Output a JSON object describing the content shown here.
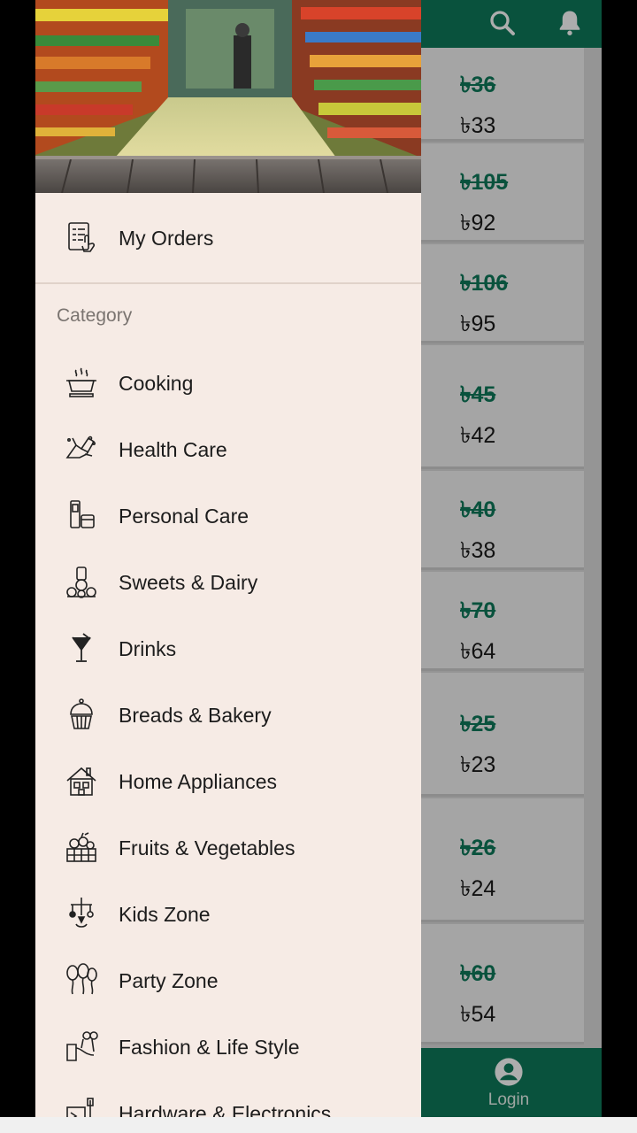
{
  "header": {
    "icons": [
      "search-icon",
      "bell-icon"
    ]
  },
  "price_cards": [
    {
      "old_price": "৳36",
      "new_price": "৳33"
    },
    {
      "old_price": "৳105",
      "new_price": "৳92"
    },
    {
      "old_price": "৳106",
      "new_price": "৳95"
    },
    {
      "old_price": "৳45",
      "new_price": "৳42"
    },
    {
      "old_price": "৳40",
      "new_price": "৳38"
    },
    {
      "old_price": "৳70",
      "new_price": "৳64"
    },
    {
      "old_price": "৳25",
      "new_price": "৳23"
    },
    {
      "old_price": "৳26",
      "new_price": "৳24"
    },
    {
      "old_price": "৳60",
      "new_price": "৳54"
    }
  ],
  "bottom_nav": {
    "login_label": "Login",
    "icon": "account-circle-icon"
  },
  "drawer": {
    "my_orders": {
      "label": "My Orders",
      "icon": "orders-list-icon"
    },
    "section_label": "Category",
    "categories": [
      {
        "label": "Cooking",
        "icon": "cooking-pot-icon"
      },
      {
        "label": "Health Care",
        "icon": "hand-wash-icon"
      },
      {
        "label": "Personal Care",
        "icon": "cosmetics-icon"
      },
      {
        "label": "Sweets & Dairy",
        "icon": "sweets-icon"
      },
      {
        "label": "Drinks",
        "icon": "cocktail-icon"
      },
      {
        "label": "Breads & Bakery",
        "icon": "cupcake-icon"
      },
      {
        "label": "Home Appliances",
        "icon": "house-icon"
      },
      {
        "label": "Fruits & Vegetables",
        "icon": "fruit-basket-icon"
      },
      {
        "label": "Kids Zone",
        "icon": "baby-mobile-icon"
      },
      {
        "label": "Party Zone",
        "icon": "balloons-icon"
      },
      {
        "label": "Fashion & Life Style",
        "icon": "glasses-icon"
      },
      {
        "label": "Hardware & Electronics",
        "icon": "hardware-icon"
      }
    ]
  },
  "colors": {
    "primary": "#0e7a5a",
    "drawer_bg": "#f6ebe5",
    "strike_price": "#0e7a5a"
  }
}
